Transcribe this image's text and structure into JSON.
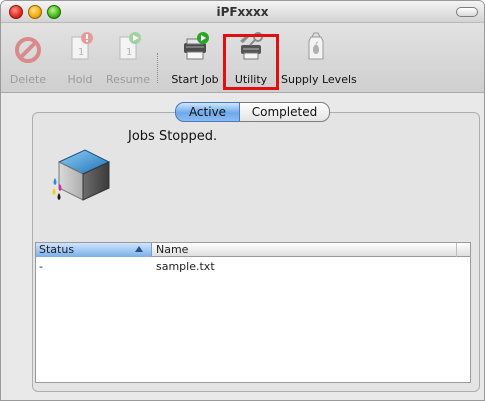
{
  "window": {
    "title": "iPFxxxx"
  },
  "toolbar": {
    "items": [
      {
        "label": "Delete",
        "enabled": false,
        "icon": "delete-icon"
      },
      {
        "label": "Hold",
        "enabled": false,
        "icon": "hold-icon"
      },
      {
        "label": "Resume",
        "enabled": false,
        "icon": "resume-icon"
      },
      {
        "label": "Start Job",
        "enabled": true,
        "icon": "start-job-icon"
      },
      {
        "label": "Utility",
        "enabled": true,
        "icon": "utility-icon"
      },
      {
        "label": "Supply Levels",
        "enabled": true,
        "icon": "supply-levels-icon"
      }
    ],
    "highlight_color": "#e01010"
  },
  "tabs": {
    "active": "Active",
    "completed": "Completed"
  },
  "status": {
    "message": "Jobs Stopped."
  },
  "table": {
    "columns": [
      "Status",
      "Name"
    ],
    "rows": [
      {
        "status": "-",
        "name": "sample.txt"
      }
    ]
  },
  "colors": {
    "accent_blue": "#6fa9ea",
    "window_bg": "#e9e9e9"
  }
}
